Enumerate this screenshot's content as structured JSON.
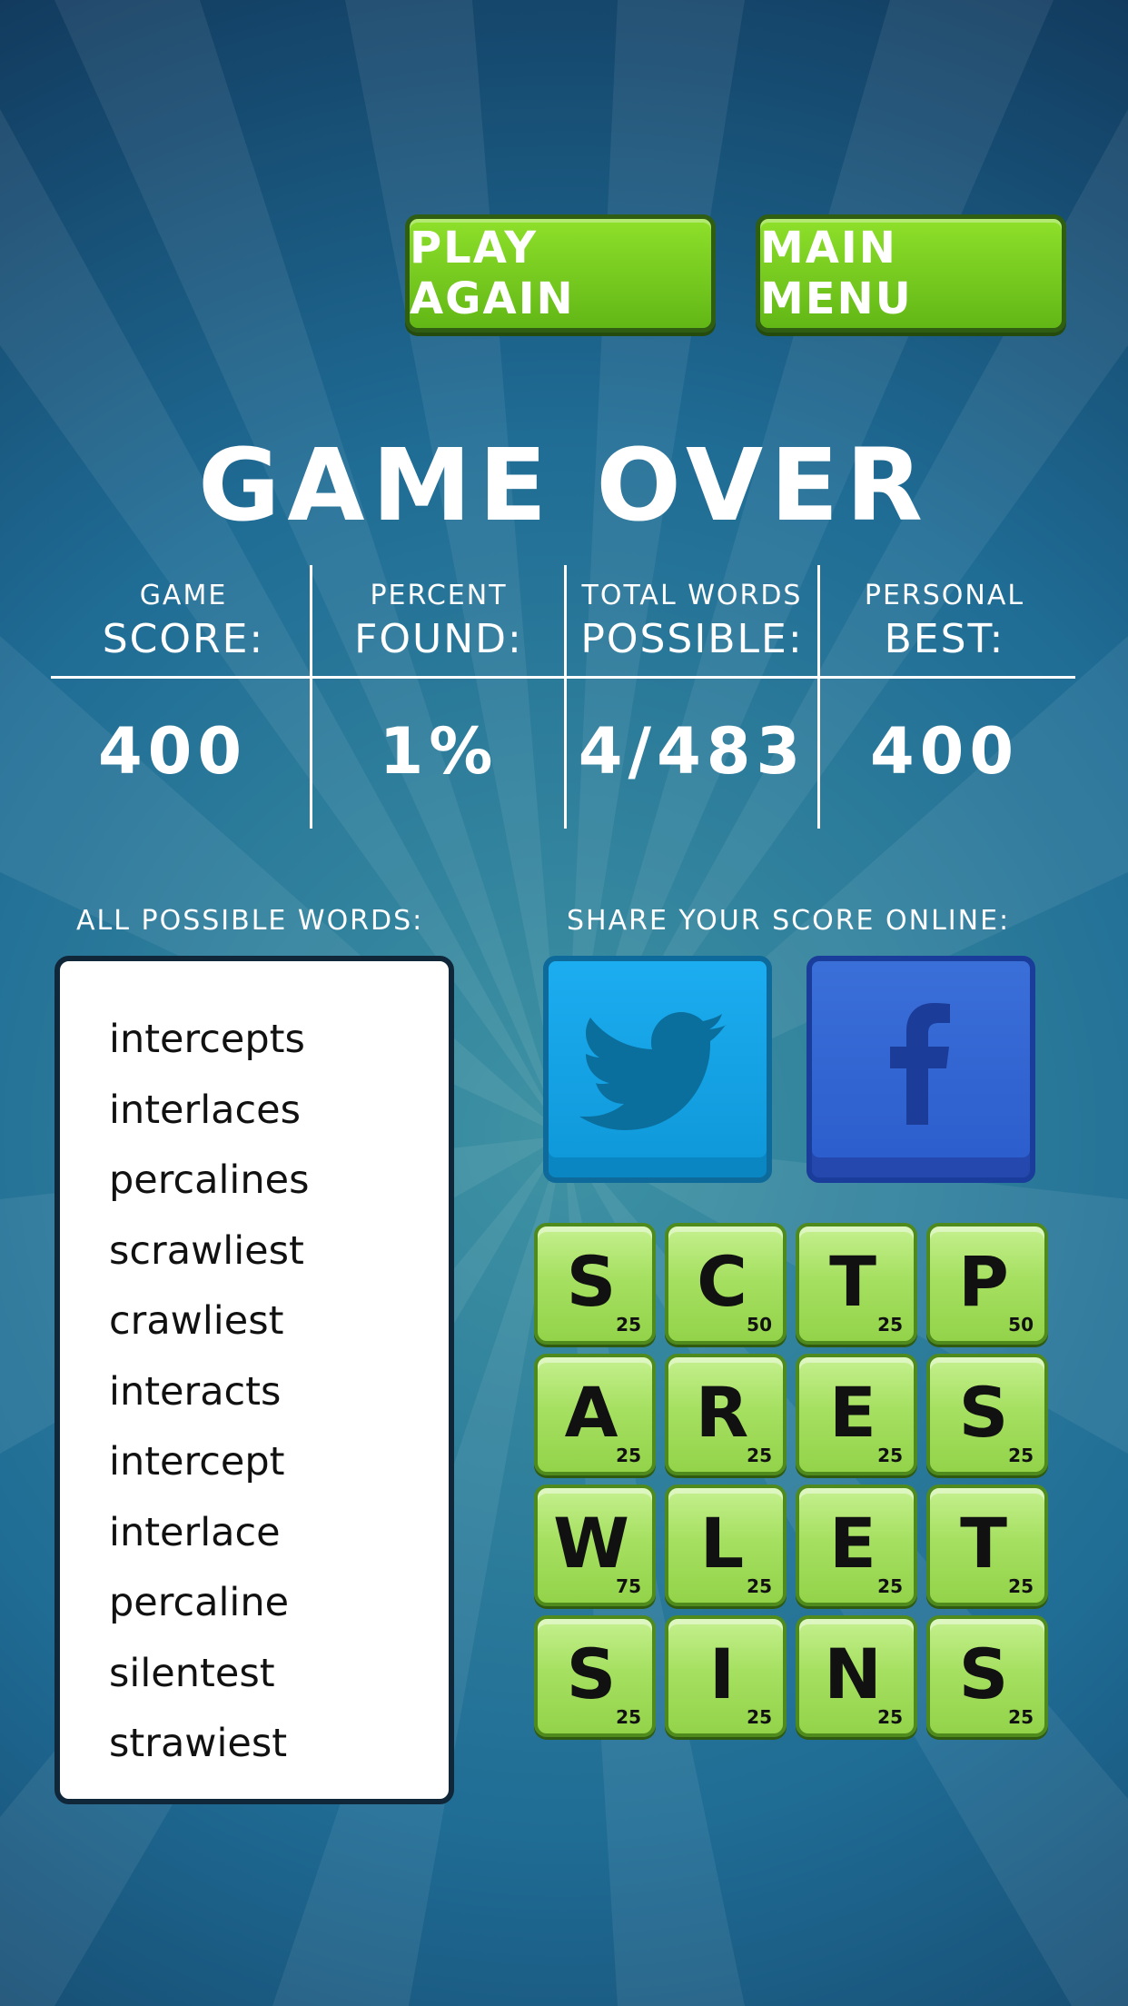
{
  "buttons": {
    "play_again": "PLAY AGAIN",
    "main_menu": "MAIN MENU"
  },
  "title": "GAME OVER",
  "stats": [
    {
      "label_top": "GAME",
      "label_bottom": "SCORE:",
      "value": "400"
    },
    {
      "label_top": "PERCENT",
      "label_bottom": "FOUND:",
      "value": "1%"
    },
    {
      "label_top": "TOTAL WORDS",
      "label_bottom": "POSSIBLE:",
      "value": "4/483"
    },
    {
      "label_top": "PERSONAL",
      "label_bottom": "BEST:",
      "value": "400"
    }
  ],
  "labels": {
    "all_words": "ALL POSSIBLE WORDS:",
    "share": "SHARE YOUR SCORE ONLINE:"
  },
  "words": [
    "intercepts",
    "interlaces",
    "percalines",
    "scrawliest",
    "crawliest",
    "interacts",
    "intercept",
    "interlace",
    "percaline",
    "silentest",
    "strawiest"
  ],
  "share": {
    "twitter_icon": "twitter-bird-icon",
    "facebook_icon": "facebook-f-icon"
  },
  "tiles": [
    {
      "letter": "S",
      "points": "25"
    },
    {
      "letter": "C",
      "points": "50"
    },
    {
      "letter": "T",
      "points": "25"
    },
    {
      "letter": "P",
      "points": "50"
    },
    {
      "letter": "A",
      "points": "25"
    },
    {
      "letter": "R",
      "points": "25"
    },
    {
      "letter": "E",
      "points": "25"
    },
    {
      "letter": "S",
      "points": "25"
    },
    {
      "letter": "W",
      "points": "75"
    },
    {
      "letter": "L",
      "points": "25"
    },
    {
      "letter": "E",
      "points": "25"
    },
    {
      "letter": "T",
      "points": "25"
    },
    {
      "letter": "S",
      "points": "25"
    },
    {
      "letter": "I",
      "points": "25"
    },
    {
      "letter": "N",
      "points": "25"
    },
    {
      "letter": "S",
      "points": "25"
    }
  ],
  "colors": {
    "background": "#1d5f86",
    "button_green": "#7ccd22",
    "tile_green": "#a6e061",
    "twitter": "#1aa6e8",
    "facebook": "#3566d4"
  }
}
